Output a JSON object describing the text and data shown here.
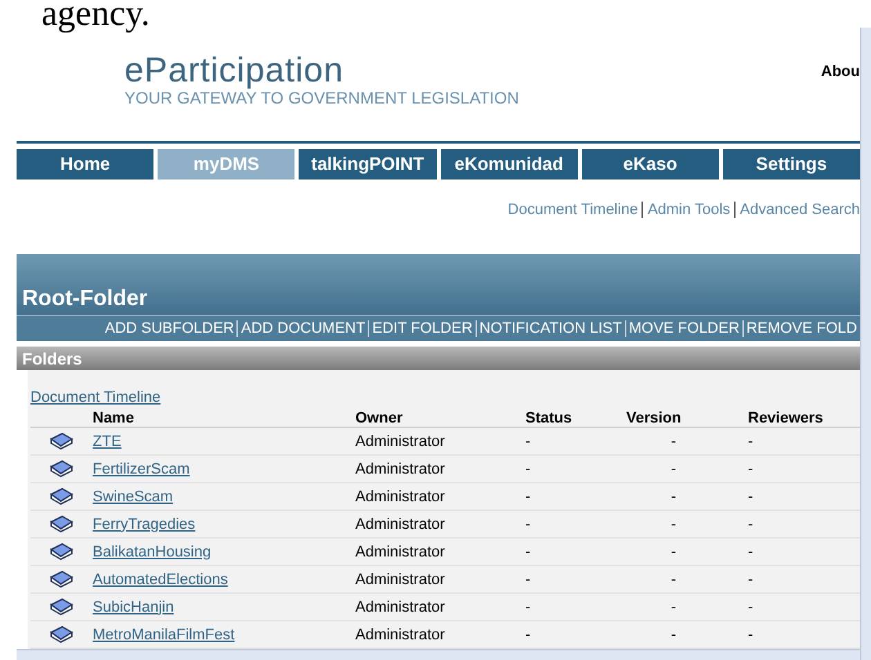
{
  "document_text": "agency.",
  "site": {
    "title": "eParticipation",
    "tagline": "YOUR GATEWAY TO GOVERNMENT LEGISLATION",
    "top_link": "Abou"
  },
  "nav": [
    {
      "label": "Home",
      "selected": false
    },
    {
      "label": "myDMS",
      "selected": true
    },
    {
      "label": "talkingPOINT",
      "selected": false
    },
    {
      "label": "eKomunidad",
      "selected": false
    },
    {
      "label": "eKaso",
      "selected": false
    },
    {
      "label": "Settings",
      "selected": false
    }
  ],
  "quick_links": [
    "Document Timeline",
    "Admin Tools",
    "Advanced Search"
  ],
  "folder": {
    "title": "Root-Folder",
    "actions": [
      "ADD SUBFOLDER",
      "ADD DOCUMENT",
      "EDIT FOLDER",
      "NOTIFICATION LIST",
      "MOVE FOLDER",
      "REMOVE FOLD"
    ]
  },
  "section_title": "Folders",
  "timeline_link": "Document Timeline",
  "table": {
    "columns": [
      "Name",
      "Owner",
      "Status",
      "Version",
      "Reviewers"
    ],
    "rows": [
      {
        "name": "ZTE",
        "owner": "Administrator",
        "status": "-",
        "version": "-",
        "reviewers": "-"
      },
      {
        "name": "FertilizerScam",
        "owner": "Administrator",
        "status": "-",
        "version": "-",
        "reviewers": "-"
      },
      {
        "name": "SwineScam",
        "owner": "Administrator",
        "status": "-",
        "version": "-",
        "reviewers": "-"
      },
      {
        "name": "FerryTragedies",
        "owner": "Administrator",
        "status": "-",
        "version": "-",
        "reviewers": "-"
      },
      {
        "name": "BalikatanHousing",
        "owner": "Administrator",
        "status": "-",
        "version": "-",
        "reviewers": "-"
      },
      {
        "name": "AutomatedElections",
        "owner": "Administrator",
        "status": "-",
        "version": "-",
        "reviewers": "-"
      },
      {
        "name": "SubicHanjin",
        "owner": "Administrator",
        "status": "-",
        "version": "-",
        "reviewers": "-"
      },
      {
        "name": "MetroManilaFilmFest",
        "owner": "Administrator",
        "status": "-",
        "version": "-",
        "reviewers": "-"
      }
    ]
  }
}
